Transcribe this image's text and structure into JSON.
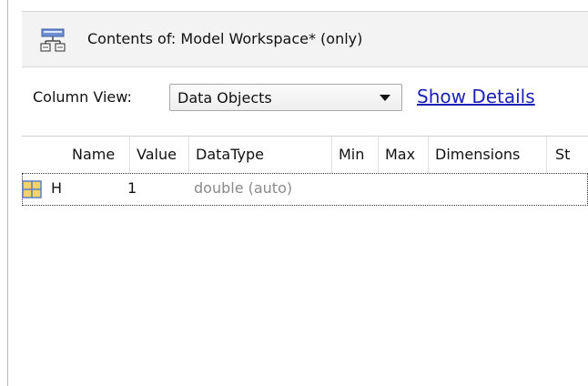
{
  "header": {
    "title": "Contents of:  Model Workspace*  (only)",
    "icon": "workspace-tree-icon"
  },
  "column_view": {
    "label": "Column View:",
    "selected": "Data Objects",
    "show_details": "Show Details"
  },
  "table": {
    "columns": [
      "Name",
      "Value",
      "DataType",
      "Min",
      "Max",
      "Dimensions",
      "St"
    ],
    "rows": [
      {
        "icon": "parameter-grid-icon",
        "name": "H",
        "value": "1",
        "datatype": "double (auto)",
        "min": "",
        "max": "",
        "dimensions": "",
        "storage": ""
      }
    ]
  },
  "colors": {
    "link": "#1b1fb8",
    "header_bg": "#f3f3f3",
    "dim_text": "#8a8a8a",
    "icon_blue": "#5b7fbf",
    "icon_yellow": "#f6d36a"
  }
}
